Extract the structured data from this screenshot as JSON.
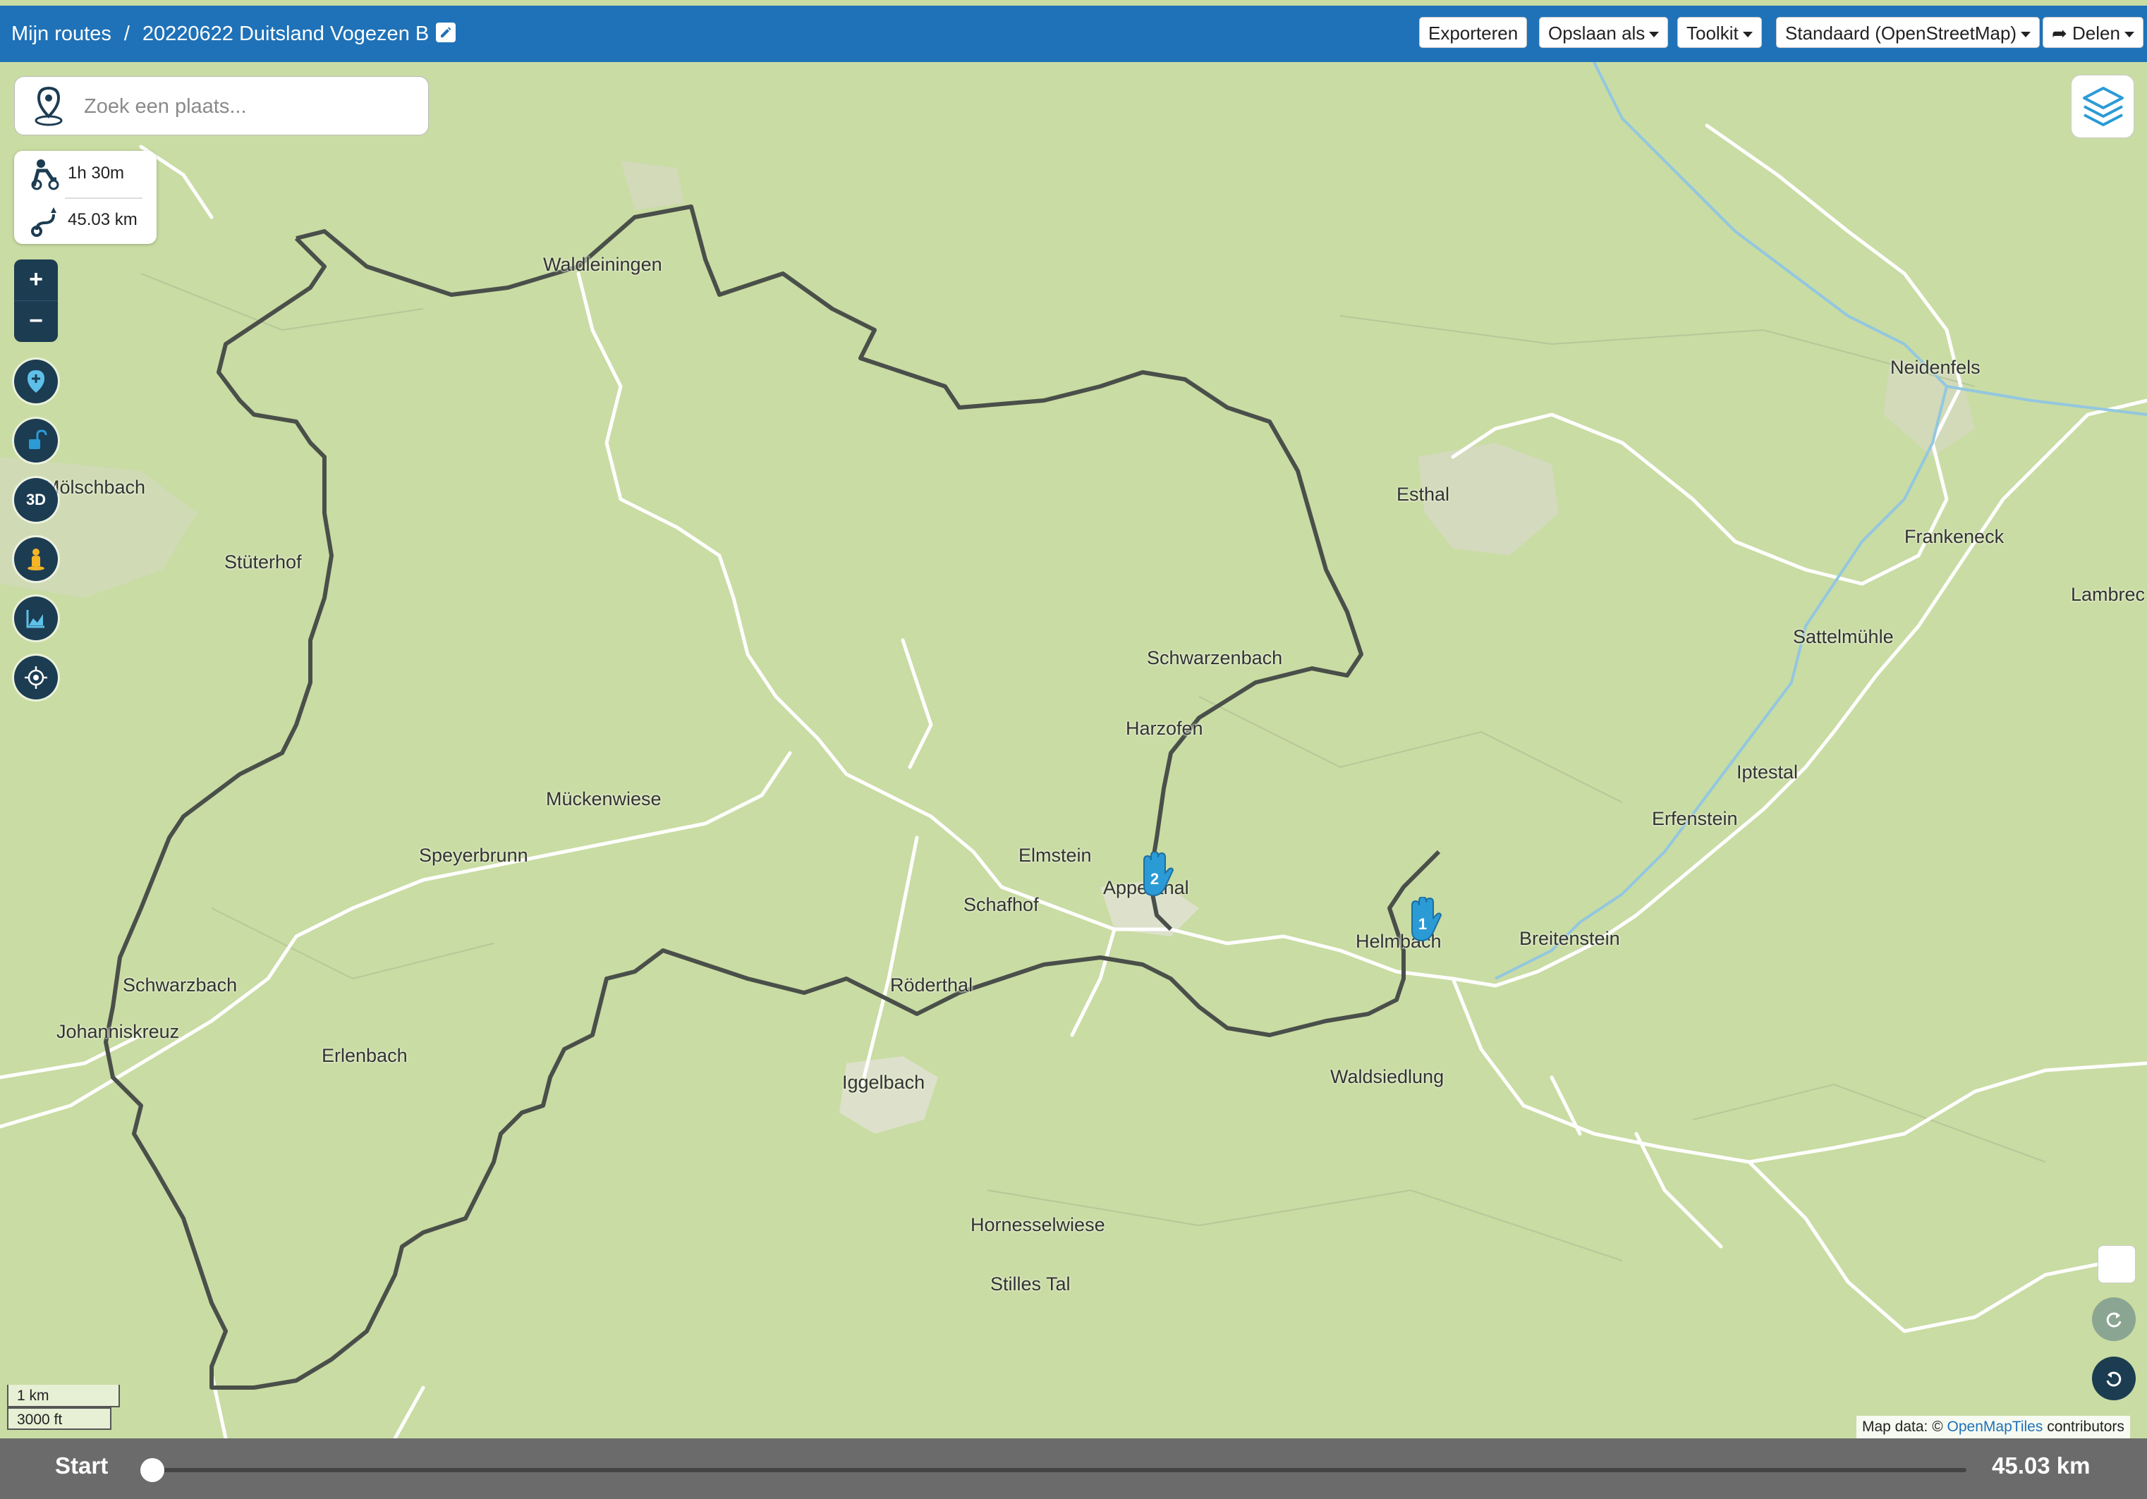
{
  "header": {
    "breadcrumb_root": "Mijn routes",
    "separator": "/",
    "route_name": "20220622 Duitsland Vogezen B",
    "buttons": {
      "export": "Exporteren",
      "save_as": "Opslaan als",
      "toolkit": "Toolkit",
      "map_style": "Standaard (OpenStreetMap)",
      "share": "Delen"
    },
    "bar_color": "#1f72b8"
  },
  "search": {
    "placeholder": "Zoek een plaats..."
  },
  "stats": {
    "duration": "1h 30m",
    "distance": "45.03 km"
  },
  "map_controls": {
    "zoom_in": "+",
    "zoom_out": "−",
    "threed_label": "3D",
    "tools": [
      "add-waypoint-icon",
      "unlock-icon",
      "3d-icon",
      "street-view-icon",
      "elevation-profile-icon",
      "locate-icon"
    ]
  },
  "places": {
    "neidenfels": "Neidenfels",
    "esthal": "Esthal",
    "frankeneck": "Frankeneck",
    "lambrecht": "Lambrec",
    "sattelmuehle": "Sattelmühle",
    "iptestal": "Iptestal",
    "erfenstein": "Erfenstein",
    "breitenstein": "Breitenstein",
    "helmbach": "Helmbach",
    "waldsiedlung": "Waldsiedlung",
    "appenthal": "Appenthal",
    "elmstein": "Elmstein",
    "schafhof": "Schafhof",
    "roederthal": "Röderthal",
    "iggelbach": "Iggelbach",
    "hornesselwiese": "Hornesselwiese",
    "stilles_tal": "Stilles Tal",
    "schwarzbach": "Schwarzbach",
    "johanniskreuz": "Johanniskreuz",
    "erlenbach": "Erlenbach",
    "speyerbrunn": "Speyerbrunn",
    "mueckenwiese": "Mückenwiese",
    "harzofen": "Harzofen",
    "schwarzenbach": "Schwarzenbach",
    "stueterhof": "Stüterhof",
    "moelschbach": "Mölschbach",
    "waldleiningen": "Waldleiningen"
  },
  "markers": [
    {
      "label": "1",
      "color": "#2b9bd6"
    },
    {
      "label": "2",
      "color": "#2b9bd6"
    }
  ],
  "scale": {
    "metric": "1 km",
    "imperial": "3000 ft"
  },
  "attribution": {
    "prefix": "Map data: ©",
    "link": "OpenMapTiles",
    "suffix": "contributors"
  },
  "bottom": {
    "start": "Start",
    "end": "45.03 km",
    "progress": 0
  },
  "colors": {
    "map_bg": "#c9dca3",
    "route": "#4a4f4a",
    "road": "#ffffff",
    "control": "#1c3c52"
  }
}
